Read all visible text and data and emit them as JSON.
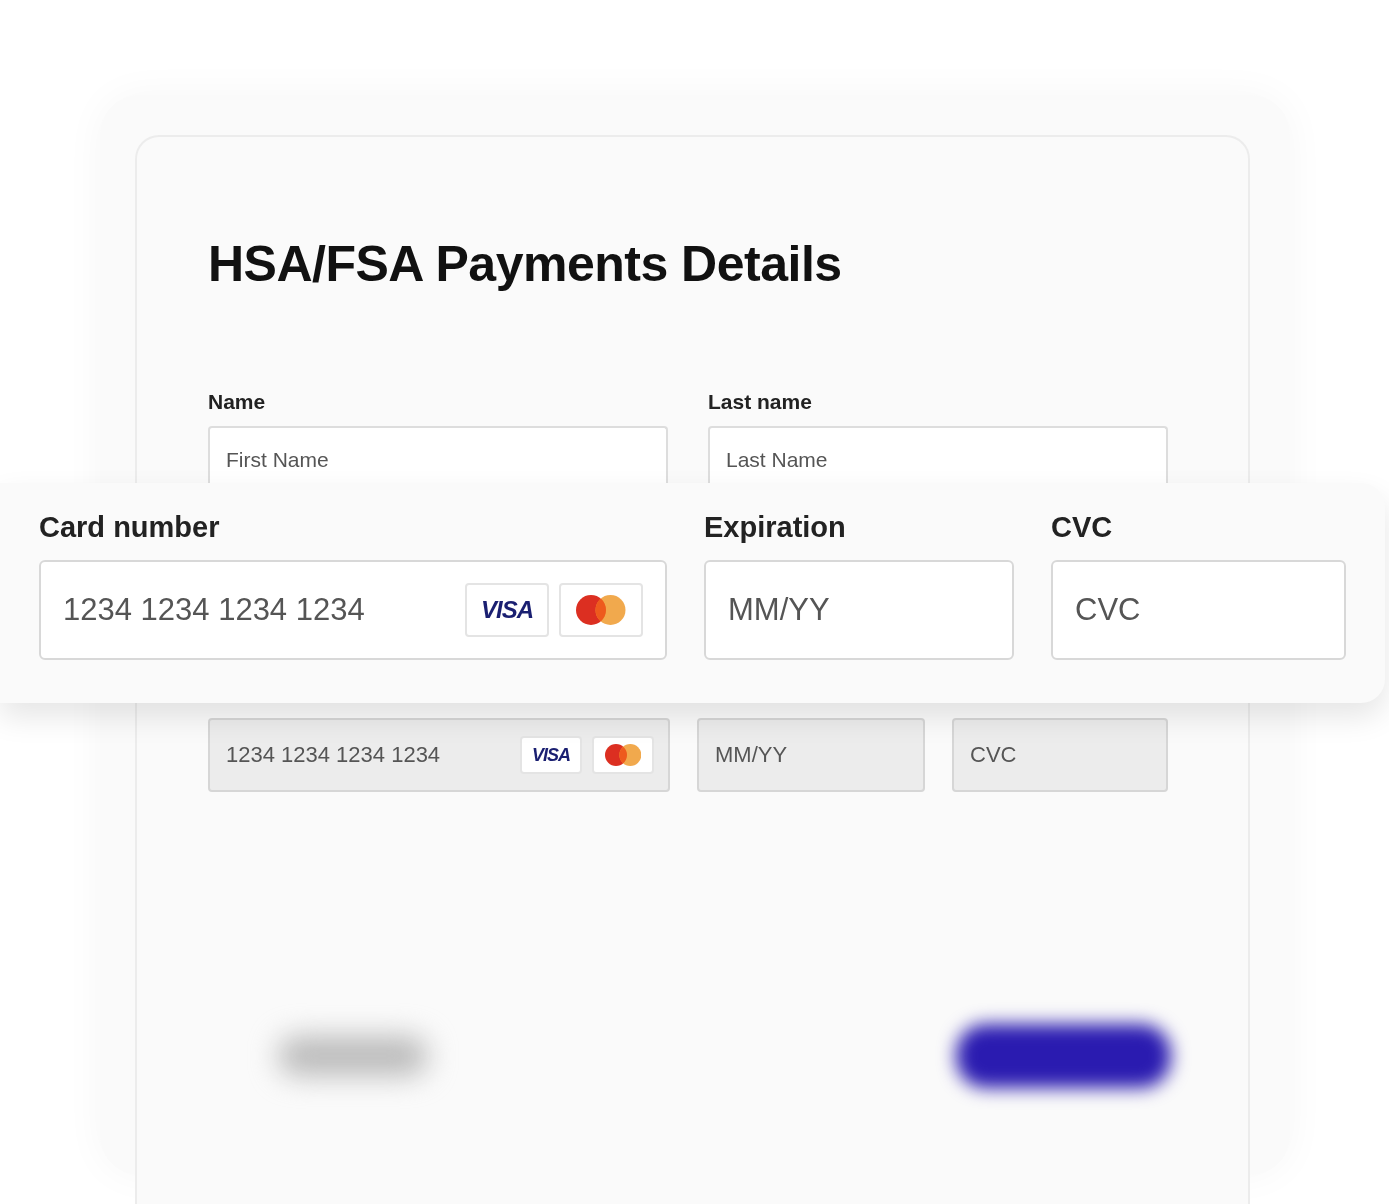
{
  "title": "HSA/FSA Payments Details",
  "name_fields": [
    {
      "label": "Name",
      "placeholder": "First Name"
    },
    {
      "label": "Last name",
      "placeholder": "Last Name"
    }
  ],
  "card_fields": [
    {
      "label": "Card number",
      "placeholder": "1234 1234 1234 1234",
      "kind": "card",
      "brand_logos": [
        {
          "kind": "visa",
          "text": "VISA"
        },
        {
          "kind": "mastercard"
        }
      ]
    },
    {
      "label": "Expiration",
      "placeholder": "MM/YY",
      "kind": "plain"
    },
    {
      "label": "CVC",
      "placeholder": "CVC",
      "kind": "plain"
    }
  ],
  "background_card_fields": [
    {
      "placeholder": "1234 1234 1234 1234",
      "kind": "card",
      "brand_logos": [
        {
          "kind": "visa",
          "text": "VISA"
        },
        {
          "kind": "mastercard"
        }
      ]
    },
    {
      "placeholder": "MM/YY",
      "kind": "plain"
    },
    {
      "placeholder": "CVC",
      "kind": "plain"
    }
  ],
  "footer_buttons": [
    {
      "kind": "secondary"
    },
    {
      "kind": "primary"
    }
  ]
}
